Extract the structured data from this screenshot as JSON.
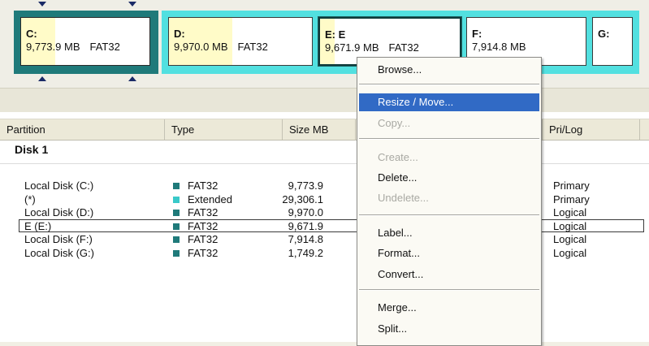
{
  "disk_map": {
    "partitions": [
      {
        "label": "C:",
        "size": "9,773.9 MB",
        "fs": "FAT32",
        "used_fraction": 0.26
      },
      {
        "label": "D:",
        "size": "9,970.0 MB",
        "fs": "FAT32",
        "used_fraction": 0.44
      },
      {
        "label": "E:",
        "volume": "E",
        "size": "9,671.9 MB",
        "fs": "FAT32",
        "used_fraction": 0.1
      },
      {
        "label": "F:",
        "size": "7,914.8 MB",
        "fs": "",
        "used_fraction": 0.0
      },
      {
        "label": "G:",
        "size": "",
        "fs": "",
        "used_fraction": 0.0
      }
    ]
  },
  "list": {
    "columns": [
      "Partition",
      "Type",
      "Size MB",
      "",
      "Pri/Log"
    ],
    "group": "Disk 1",
    "rows": [
      {
        "name": "Local Disk (C:)",
        "type": "FAT32",
        "size": "9,773.9",
        "pri": "Primary",
        "color": "#1f7a7a"
      },
      {
        "name": "(*)",
        "type": "Extended",
        "size": "29,306.1",
        "pri": "Primary",
        "color": "#39c9c9"
      },
      {
        "name": "Local Disk (D:)",
        "type": "FAT32",
        "size": "9,970.0",
        "pri": "Logical",
        "color": "#1f7a7a"
      },
      {
        "name": "E (E:)",
        "type": "FAT32",
        "size": "9,671.9",
        "pri": "Logical",
        "color": "#1f7a7a"
      },
      {
        "name": "Local Disk (F:)",
        "type": "FAT32",
        "size": "7,914.8",
        "pri": "Logical",
        "color": "#1f7a7a"
      },
      {
        "name": "Local Disk (G:)",
        "type": "FAT32",
        "size": "1,749.2",
        "pri": "Logical",
        "color": "#1f7a7a"
      }
    ]
  },
  "context_menu": {
    "items": [
      {
        "label": "Browse...",
        "state": "normal"
      },
      {
        "label": "Resize / Move...",
        "state": "highlighted"
      },
      {
        "label": "Copy...",
        "state": "disabled"
      },
      {
        "label": "Create...",
        "state": "disabled"
      },
      {
        "label": "Delete...",
        "state": "normal"
      },
      {
        "label": "Undelete...",
        "state": "disabled"
      },
      {
        "label": "Label...",
        "state": "normal"
      },
      {
        "label": "Format...",
        "state": "normal"
      },
      {
        "label": "Convert...",
        "state": "normal"
      },
      {
        "label": "Merge...",
        "state": "normal"
      },
      {
        "label": "Split...",
        "state": "normal"
      }
    ]
  },
  "colors": {
    "primary_partition": "#1f7a7a",
    "extended_partition": "#52e0e0",
    "used_space": "#fffbc8",
    "menu_highlight": "#316ac5"
  }
}
